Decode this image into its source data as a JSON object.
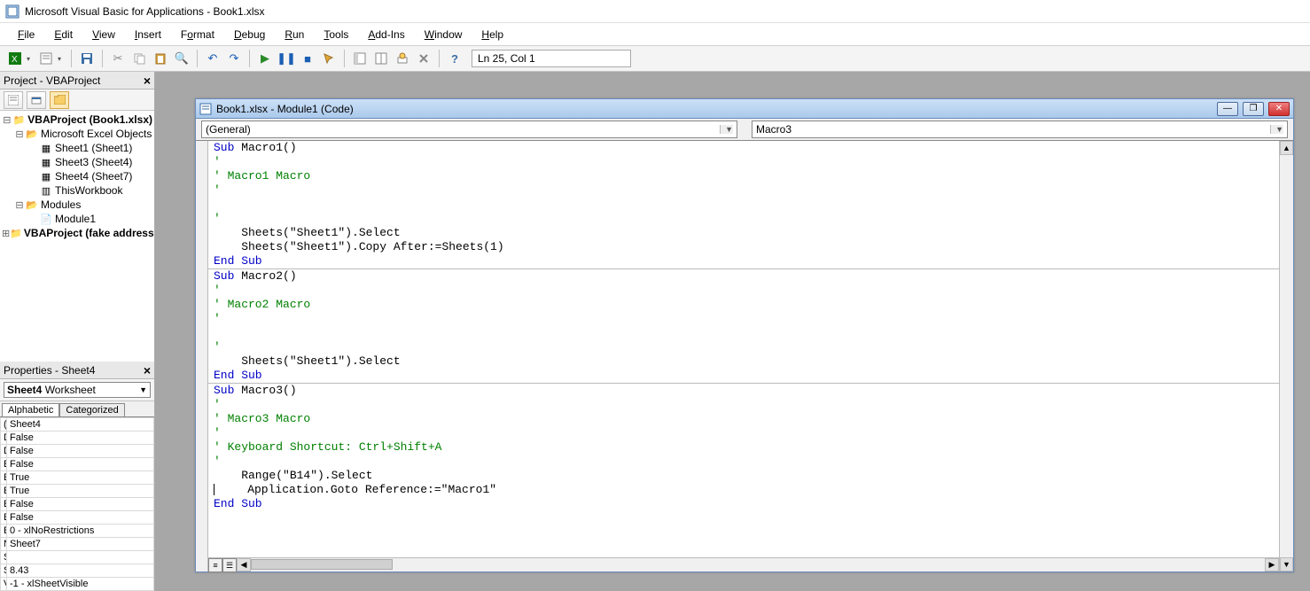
{
  "title": "Microsoft Visual Basic for Applications - Book1.xlsx",
  "menu": [
    "File",
    "Edit",
    "View",
    "Insert",
    "Format",
    "Debug",
    "Run",
    "Tools",
    "Add-Ins",
    "Window",
    "Help"
  ],
  "cursor_position": "Ln 25, Col 1",
  "project_panel": {
    "title": "Project - VBAProject",
    "tree": {
      "root1": "VBAProject (Book1.xlsx)",
      "group1": "Microsoft Excel Objects",
      "sheets": [
        "Sheet1 (Sheet1)",
        "Sheet3 (Sheet4)",
        "Sheet4 (Sheet7)"
      ],
      "this_wb": "ThisWorkbook",
      "group2": "Modules",
      "modules": [
        "Module1"
      ],
      "root2": "VBAProject (fake address"
    }
  },
  "properties_panel": {
    "title": "Properties - Sheet4",
    "select_bold": "Sheet4",
    "select_rest": " Worksheet",
    "tabs": [
      "Alphabetic",
      "Categorized"
    ],
    "rows": [
      [
        "(Name)",
        "Sheet4"
      ],
      [
        "DisplayPageBreaks",
        "False"
      ],
      [
        "DisplayRightToLeft",
        "False"
      ],
      [
        "EnableAutoFilter",
        "False"
      ],
      [
        "EnableCalculation",
        "True"
      ],
      [
        "EnableFormatConditionsCalculation",
        "True"
      ],
      [
        "EnableOutlining",
        "False"
      ],
      [
        "EnablePivotTable",
        "False"
      ],
      [
        "EnableSelection",
        "0 - xlNoRestrictions"
      ],
      [
        "Name",
        "Sheet7"
      ],
      [
        "ScrollArea",
        ""
      ],
      [
        "StandardWidth",
        "8.43"
      ],
      [
        "Visible",
        "-1 - xlSheetVisible"
      ]
    ]
  },
  "code_window": {
    "title": "Book1.xlsx - Module1 (Code)",
    "left_combo": "(General)",
    "right_combo": "Macro3"
  },
  "code": {
    "sub1_sig": {
      "sub": "Sub",
      "name": " Macro1()"
    },
    "c1a": "'",
    "c1b": "' Macro1 Macro",
    "c1c": "'",
    "blank": "",
    "c1d": "'",
    "l1": "    Sheets(\"Sheet1\").Select",
    "l2": "    Sheets(\"Sheet1\").Copy After:=Sheets(1)",
    "end": "End Sub",
    "sub2_sig": {
      "sub": "Sub",
      "name": " Macro2()"
    },
    "c2a": "'",
    "c2b": "' Macro2 Macro",
    "c2c": "'",
    "c2d": "'",
    "l3": "    Sheets(\"Sheet1\").Select",
    "sub3_sig": {
      "sub": "Sub",
      "name": " Macro3()"
    },
    "c3a": "'",
    "c3b": "' Macro3 Macro",
    "c3c": "'",
    "c3d": "' Keyboard Shortcut: Ctrl+Shift+A",
    "c3e": "'",
    "l4": "    Range(\"B14\").Select",
    "l5": "    Application.Goto Reference:=\"Macro1\""
  }
}
